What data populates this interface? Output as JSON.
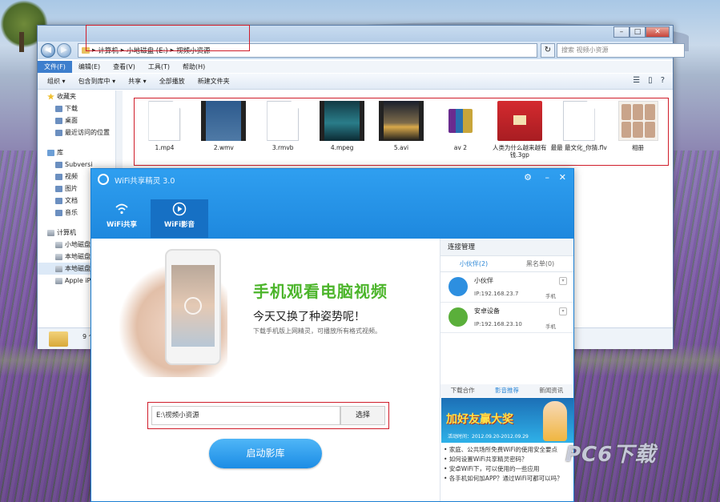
{
  "explorer": {
    "breadcrumbs": [
      "计算机",
      "小地磁盘 (E:)",
      "视频小资源"
    ],
    "search_placeholder": "搜索 视频小资源",
    "window_buttons": {
      "min": "–",
      "max": "□",
      "close": "✕"
    },
    "nav": {
      "back": "◀",
      "forward": "▶",
      "refresh": "↻"
    },
    "menus": [
      "文件(F)",
      "编辑(E)",
      "查看(V)",
      "工具(T)",
      "帮助(H)"
    ],
    "toolbar": [
      "组织 ▾",
      "包含到库中 ▾",
      "共享 ▾",
      "全部播放",
      "新建文件夹"
    ],
    "toolbar_right": [
      "☰",
      "▯",
      "?"
    ],
    "sidebar": [
      {
        "label": "收藏夹",
        "icon": "star-icon",
        "sub": false
      },
      {
        "label": "下载",
        "icon": "folder-icon",
        "sub": true
      },
      {
        "label": "桌面",
        "icon": "folder-icon",
        "sub": true
      },
      {
        "label": "最近访问的位置",
        "icon": "folder-icon",
        "sub": true
      },
      {
        "label": "库",
        "icon": "library-icon",
        "sub": false
      },
      {
        "label": "Subversi",
        "icon": "folder-icon",
        "sub": true
      },
      {
        "label": "视频",
        "icon": "folder-icon",
        "sub": true
      },
      {
        "label": "图片",
        "icon": "folder-icon",
        "sub": true
      },
      {
        "label": "文档",
        "icon": "folder-icon",
        "sub": true
      },
      {
        "label": "音乐",
        "icon": "folder-icon",
        "sub": true
      },
      {
        "label": "计算机",
        "icon": "computer-icon",
        "sub": false
      },
      {
        "label": "小地磁盘",
        "icon": "drive-icon",
        "sub": true
      },
      {
        "label": "本地磁盘",
        "icon": "drive-icon",
        "sub": true
      },
      {
        "label": "本地磁盘",
        "icon": "drive-icon",
        "sub": true
      },
      {
        "label": "Apple iP",
        "icon": "drive-icon",
        "sub": true
      }
    ],
    "files": [
      {
        "name": "1.mp4",
        "type": "doc"
      },
      {
        "name": "2.wmv",
        "type": "video-news"
      },
      {
        "name": "3.rmvb",
        "type": "doc"
      },
      {
        "name": "4.mpeg",
        "type": "video-teal"
      },
      {
        "name": "5.avi",
        "type": "video-sunset"
      },
      {
        "name": "av 2",
        "type": "rar"
      },
      {
        "name": "人类为什么越来越有钱.3gp",
        "type": "redcard"
      },
      {
        "name": "最最 最文化_你猜.flv",
        "type": "doc"
      },
      {
        "name": "相册",
        "type": "album"
      }
    ],
    "status": "9 个"
  },
  "wifi": {
    "title": "WiFi共享精灵 3.0",
    "header_controls": [
      "⚙",
      "–",
      "✕"
    ],
    "tabs": [
      {
        "label": "WiFi共享",
        "icon": "wifi-icon"
      },
      {
        "label": "WiFi影音",
        "icon": "play-icon"
      }
    ],
    "slogan_main": "手机观看电脑视频",
    "slogan_sub": "今天又换了种姿势呢！",
    "slogan_desc": "下载手机版上网精灵，可播放所有格式视频。",
    "path_value": "E:\\视频小资源",
    "pick_button": "选择",
    "start_button": "启动影库",
    "right_panel": {
      "title": "连接管理",
      "tabs": [
        "小伙伴(2)",
        "黑名单(0)"
      ],
      "devices": [
        {
          "name": "小伙伴",
          "ip": "IP:192.168.23.7",
          "tag": "手机",
          "icon": "iphone-icon"
        },
        {
          "name": "安卓设备",
          "ip": "IP:192.168.23.10",
          "tag": "手机",
          "icon": "android-icon"
        }
      ],
      "news_tabs": [
        "下载合作",
        "影音推荐",
        "新闻资讯"
      ],
      "banner_title": "加好友赢大奖",
      "banner_sub": "活动时间：2012.09.20-2012.09.29",
      "news": [
        "家庭、公共场所免费WiFi的使用安全要点",
        "如何设置WiFi共享精灵密码？",
        "安卓WiFi下，可以使用的一些应用",
        "各手机如何加APP？通过WiFi可都可以吗？"
      ]
    }
  },
  "watermark": "PC6下载"
}
